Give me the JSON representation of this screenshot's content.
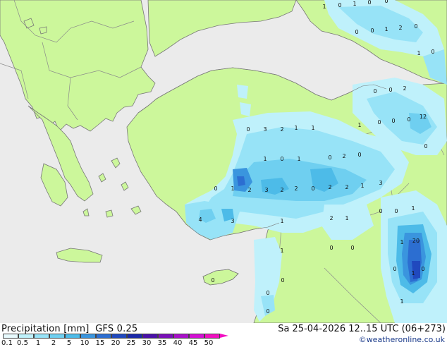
{
  "title": "Precipitation [mm]",
  "model": "GFS 0.25",
  "valid": "Sa 25-04-2026 12..15 UTC (06+273)",
  "credit": "©weatheronline.co.uk",
  "colors": {
    "sea": "#ebebeb",
    "land": "#ccf79b",
    "border": "#8a8a8a",
    "coast": "#777777"
  },
  "legend": {
    "labels": [
      "0.1",
      "0.5",
      "1",
      "2",
      "5",
      "10",
      "15",
      "20",
      "25",
      "30",
      "35",
      "40",
      "45",
      "50"
    ],
    "colors": [
      "#e8fafd",
      "#bff1fb",
      "#97e3f7",
      "#6fcff0",
      "#4dbbe8",
      "#3a95de",
      "#2c6ed1",
      "#2049be",
      "#1a28a8",
      "#4a10a8",
      "#7a10b8",
      "#a810c8",
      "#d410d4",
      "#f010c0"
    ]
  },
  "map_labels": [
    {
      "t": "1"
    },
    {
      "t": "0"
    },
    {
      "t": "1"
    },
    {
      "t": "0"
    },
    {
      "t": "0"
    },
    {
      "t": "0"
    },
    {
      "t": "0"
    },
    {
      "t": "1"
    },
    {
      "t": "2"
    },
    {
      "t": "0"
    },
    {
      "t": "1"
    },
    {
      "t": "0"
    },
    {
      "t": "2"
    },
    {
      "t": "0"
    },
    {
      "t": "0"
    },
    {
      "t": "12"
    },
    {
      "t": "0"
    },
    {
      "t": "0"
    },
    {
      "t": "0"
    },
    {
      "t": "0"
    },
    {
      "t": "1"
    },
    {
      "t": "0"
    },
    {
      "t": "3"
    },
    {
      "t": "2"
    },
    {
      "t": "1"
    },
    {
      "t": "1"
    },
    {
      "t": "0"
    },
    {
      "t": "2"
    },
    {
      "t": "0"
    },
    {
      "t": "1"
    },
    {
      "t": "0"
    },
    {
      "t": "1"
    },
    {
      "t": "2"
    },
    {
      "t": "3"
    },
    {
      "t": "2"
    },
    {
      "t": "2"
    },
    {
      "t": "0"
    },
    {
      "t": "2"
    },
    {
      "t": "2"
    },
    {
      "t": "1"
    },
    {
      "t": "3"
    },
    {
      "t": "0"
    },
    {
      "t": "1"
    },
    {
      "t": "4"
    },
    {
      "t": "3"
    },
    {
      "t": "1"
    },
    {
      "t": "2"
    },
    {
      "t": "1"
    },
    {
      "t": "0"
    },
    {
      "t": "0"
    },
    {
      "t": "0"
    },
    {
      "t": "0"
    },
    {
      "t": "1"
    },
    {
      "t": "20"
    },
    {
      "t": "1"
    },
    {
      "t": "0"
    },
    {
      "t": "0"
    },
    {
      "t": "1"
    },
    {
      "t": "0"
    },
    {
      "t": "0"
    },
    {
      "t": "1"
    },
    {
      "t": "0"
    },
    {
      "t": "0"
    },
    {
      "t": "1"
    }
  ]
}
